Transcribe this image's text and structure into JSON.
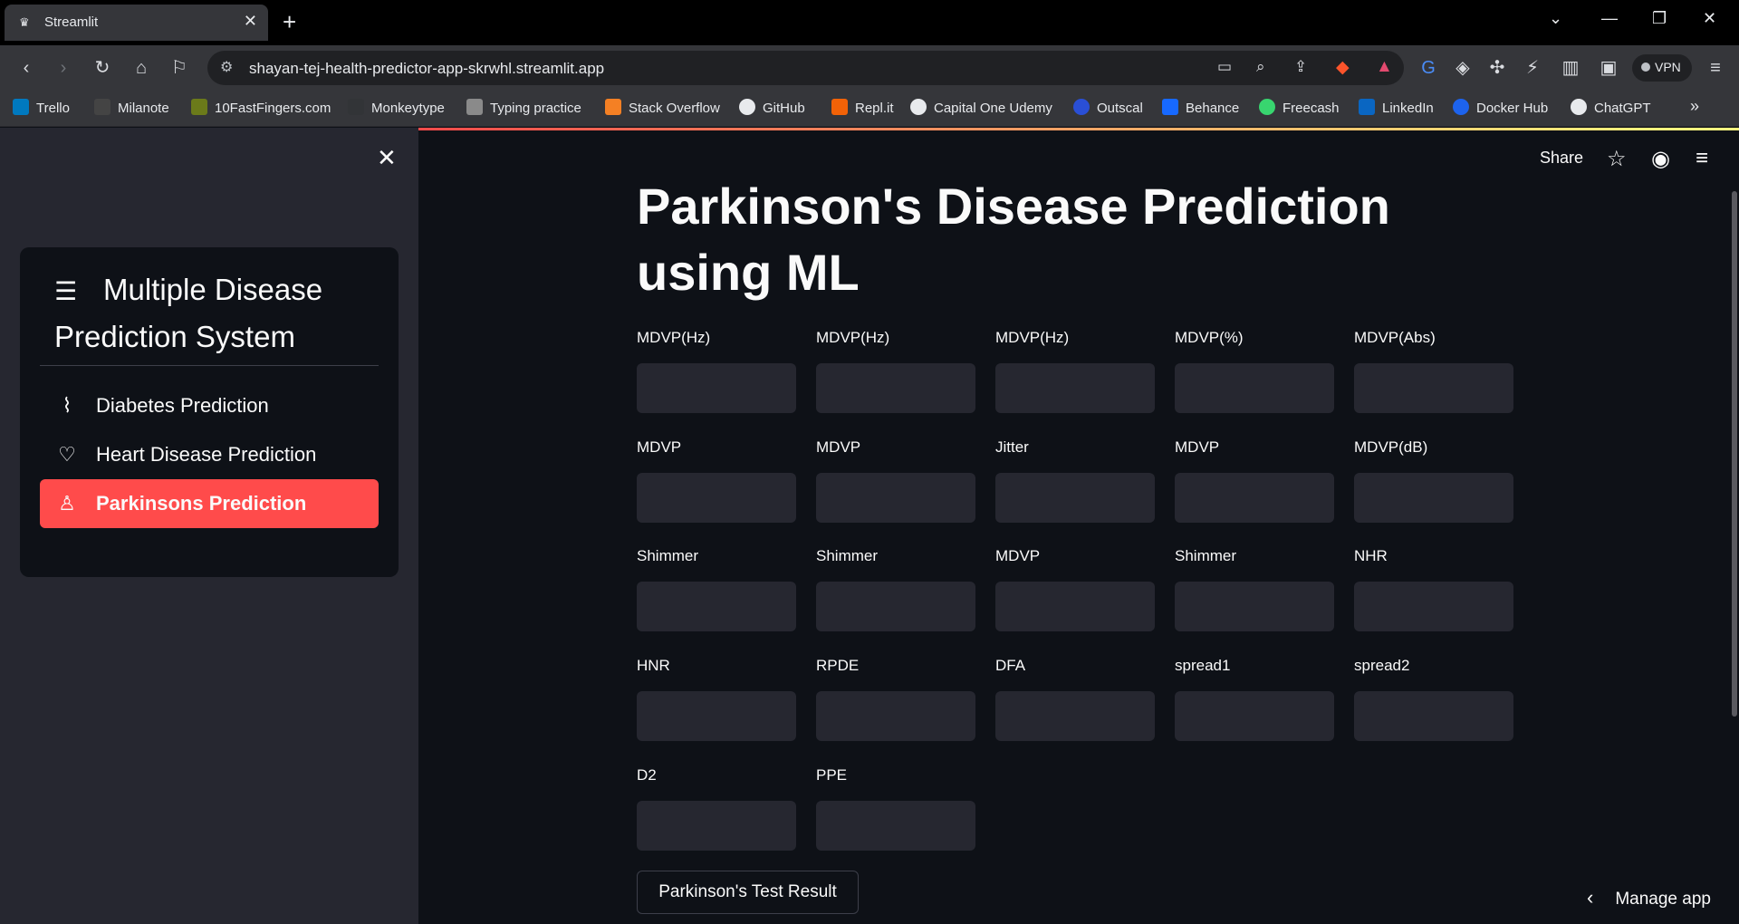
{
  "browser": {
    "tab_title": "Streamlit",
    "url": "shayan-tej-health-predictor-app-skrwhl.streamlit.app",
    "vpn_label": "VPN",
    "bookmarks": [
      "Trello",
      "Milanote",
      "10FastFingers.com",
      "Monkeytype",
      "Typing practice",
      "Stack Overflow",
      "GitHub",
      "Repl.it",
      "Capital One Udemy",
      "Outscal",
      "Behance",
      "Freecash",
      "LinkedIn",
      "Docker Hub",
      "ChatGPT"
    ]
  },
  "sidebar": {
    "title": "Multiple Disease Prediction System",
    "items": [
      {
        "label": "Diabetes Prediction",
        "icon": "activity-icon"
      },
      {
        "label": "Heart Disease Prediction",
        "icon": "heart-icon"
      },
      {
        "label": "Parkinsons Prediction",
        "icon": "person-icon",
        "active": true
      }
    ],
    "active_color": "#ff4b4b"
  },
  "header": {
    "share_label": "Share"
  },
  "main": {
    "title": "Parkinson's Disease Prediction using ML",
    "fields": [
      [
        "MDVP(Hz)",
        "MDVP(Hz)",
        "MDVP(Hz)",
        "MDVP(%)",
        "MDVP(Abs)"
      ],
      [
        "MDVP",
        "MDVP",
        "Jitter",
        "MDVP",
        "MDVP(dB)"
      ],
      [
        "Shimmer",
        "Shimmer",
        "MDVP",
        "Shimmer",
        "NHR"
      ],
      [
        "HNR",
        "RPDE",
        "DFA",
        "spread1",
        "spread2"
      ],
      [
        "D2",
        "PPE"
      ]
    ],
    "submit_label": "Parkinson's Test Result",
    "manage_label": "Manage app"
  }
}
